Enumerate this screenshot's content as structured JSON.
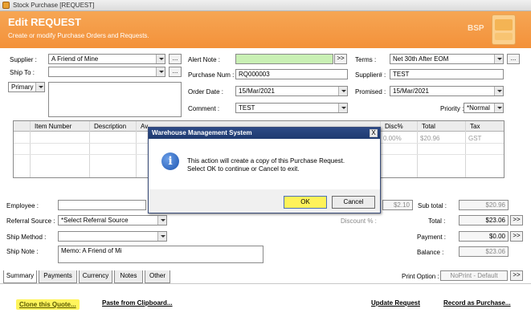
{
  "window": {
    "title": "Stock Purchase [REQUEST]"
  },
  "header": {
    "title": "Edit REQUEST",
    "subtitle": "Create or modify Purchase Orders and Requests.",
    "logo_text": "BSP"
  },
  "form": {
    "supplier_label": "Supplier :",
    "supplier_value": "A Friend of Mine",
    "ship_to_label": "Ship To :",
    "ship_to_value": "",
    "ship_to_type": "Primary",
    "address_value": "",
    "alert_note_label": "Alert Note :",
    "alert_note_value": "",
    "alert_note_button": ">>",
    "purchase_num_label": "Purchase Num :",
    "purchase_num_value": "RQ000003",
    "order_date_label": "Order Date :",
    "order_date_value": "15/Mar/2021",
    "comment_label": "Comment :",
    "comment_value": "TEST",
    "terms_label": "Terms :",
    "terms_value": "Net 30th After EOM",
    "supplier_no_label": "Supplier# :",
    "supplier_no_value": "TEST",
    "promised_label": "Promised :",
    "promised_value": "15/Mar/2021",
    "priority_label": "Priority :",
    "priority_value": "*Normal",
    "browse_button": "..."
  },
  "grid": {
    "columns": [
      "Item Number",
      "Description",
      "Av",
      "",
      "",
      "Disc%",
      "Total",
      "Tax"
    ],
    "row": {
      "disc": "0.00%",
      "total": "$20.96",
      "tax": "GST"
    }
  },
  "lower": {
    "employee_label": "Employee :",
    "employee_value": "",
    "referral_label": "Referral Source :",
    "referral_value": "*Select Referral Source",
    "ship_method_label": "Ship Method :",
    "ship_method_value": "",
    "ship_note_label": "Ship Note :",
    "ship_note_value": "Memo: A Friend of Mi",
    "discount_label": "Discount % :",
    "freight_value": "$2.10",
    "subtotal_label": "Sub total :",
    "subtotal_value": "$20.96",
    "total_label": "Total :",
    "total_value": "$23.06",
    "payment_label": "Payment :",
    "payment_value": "$0.00",
    "balance_label": "Balance :",
    "balance_value": "$23.06",
    "more_button": ">>"
  },
  "tabs": [
    "Summary",
    "Payments",
    "Currency",
    "Notes",
    "Other"
  ],
  "footer": {
    "print_option_label": "Print Option :",
    "print_option_value": "NoPrint - Default",
    "print_button": ">>",
    "clone_link": "Clone this Quote...",
    "paste_link": "Paste from Clipboard...",
    "update_link": "Update Request",
    "record_link": "Record as Purchase..."
  },
  "dialog": {
    "title": "Warehouse Management System",
    "close": "X",
    "icon": "i",
    "message_line1": "This action will create a copy of this Purchase Request.",
    "message_line2": "Select OK to continue or Cancel to exit.",
    "ok_label": "OK",
    "cancel_label": "Cancel"
  },
  "colors": {
    "header_orange": "#f3913a",
    "alert_green": "#c9f0b4",
    "highlight_yellow": "#fff25a",
    "dialog_title_blue": "#1f3a70"
  }
}
